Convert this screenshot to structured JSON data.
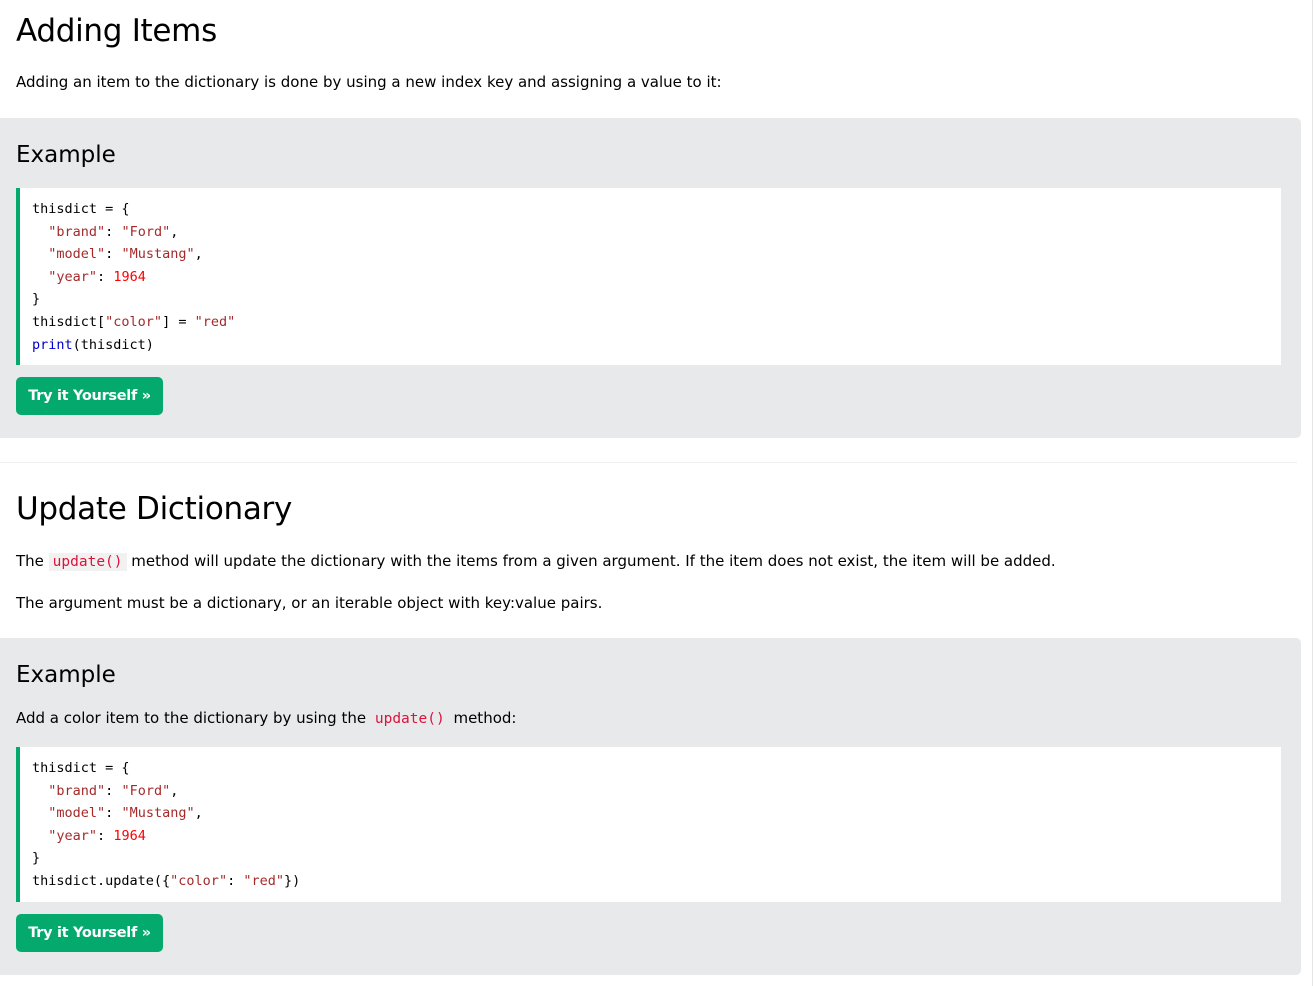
{
  "section1": {
    "heading": "Adding Items",
    "intro": "Adding an item to the dictionary is done by using a new index key and assigning a value to it:",
    "example": {
      "title": "Example",
      "code": {
        "l1": "thisdict = {",
        "l2_key": "\"brand\"",
        "l2_sep": ": ",
        "l2_val": "\"Ford\"",
        "l2_end": ",",
        "l3_key": "\"model\"",
        "l3_sep": ": ",
        "l3_val": "\"Mustang\"",
        "l3_end": ",",
        "l4_key": "\"year\"",
        "l4_sep": ": ",
        "l4_val": "1964",
        "l5": "}",
        "l6_a": "thisdict[",
        "l6_key": "\"color\"",
        "l6_b": "] = ",
        "l6_val": "\"red\"",
        "l7_kw": "print",
        "l7_rest": "(thisdict)"
      },
      "button": "Try it Yourself »"
    }
  },
  "section2": {
    "heading": "Update Dictionary",
    "p1_before": "The ",
    "p1_code": "update()",
    "p1_after": " method will update the dictionary with the items from a given argument. If the item does not exist, the item will be added.",
    "p2": "The argument must be a dictionary, or an iterable object with key:value pairs.",
    "example": {
      "title": "Example",
      "desc_before": "Add a color item to the dictionary by using the ",
      "desc_code": "update()",
      "desc_after": " method:",
      "code": {
        "l1": "thisdict = {",
        "l2_key": "\"brand\"",
        "l2_sep": ": ",
        "l2_val": "\"Ford\"",
        "l2_end": ",",
        "l3_key": "\"model\"",
        "l3_sep": ": ",
        "l3_val": "\"Mustang\"",
        "l3_end": ",",
        "l4_key": "\"year\"",
        "l4_sep": ": ",
        "l4_val": "1964",
        "l5": "}",
        "l6_a": "thisdict.update({",
        "l6_key": "\"color\"",
        "l6_b": ": ",
        "l6_val": "\"red\"",
        "l6_c": "})"
      },
      "button": "Try it Yourself »"
    }
  },
  "colors": {
    "accent_green": "#04aa6d",
    "example_bg": "#e7e9eb",
    "string_color": "#a52a2a",
    "number_color": "#ff0000",
    "keyword_color": "#0000cd",
    "inline_code_color": "#dc143c"
  }
}
